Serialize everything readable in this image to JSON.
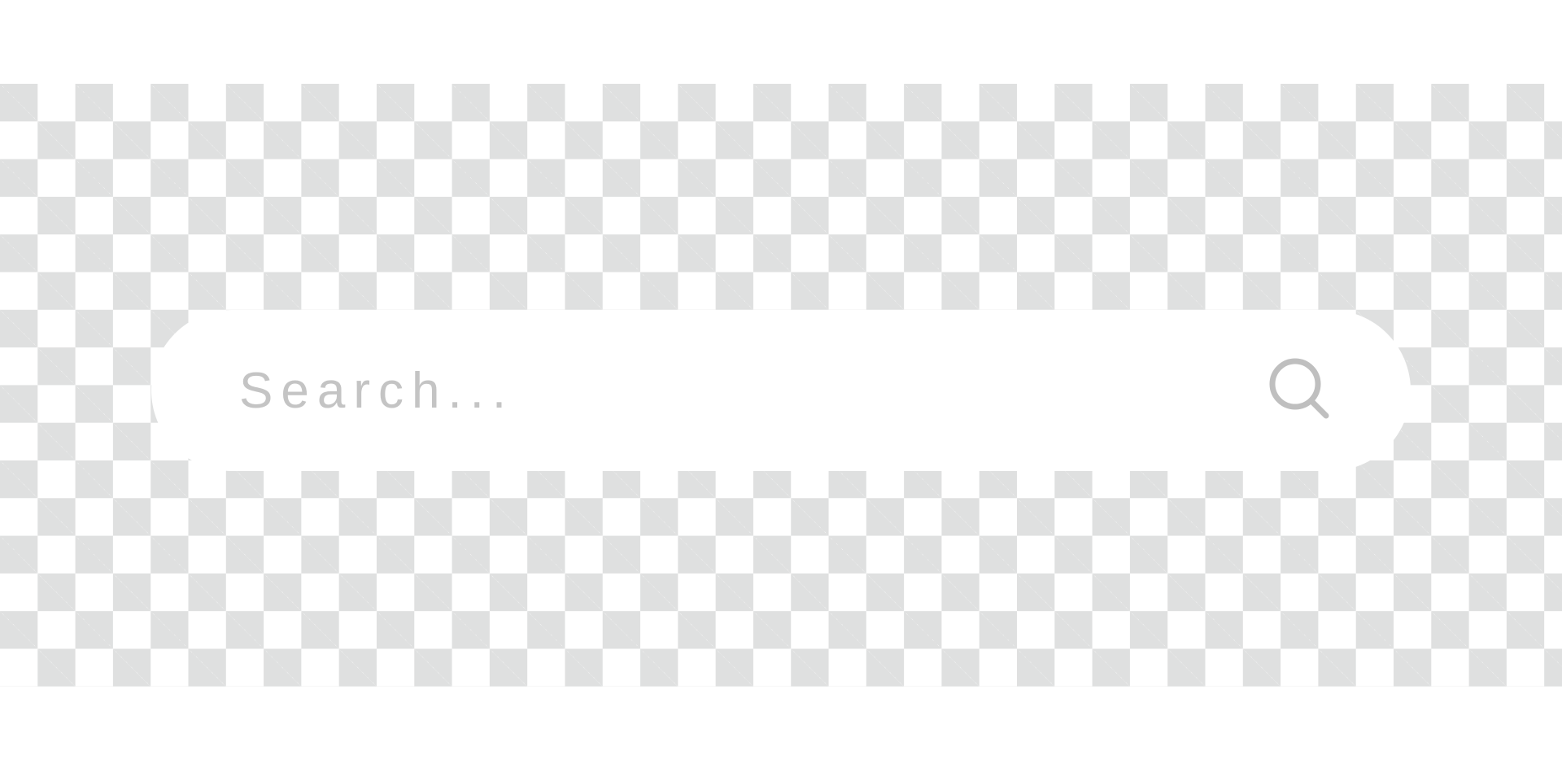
{
  "search": {
    "placeholder": "Search...",
    "icon": "search-icon"
  },
  "colors": {
    "checker_light": "#ffffff",
    "checker_dark": "#dfe0e0",
    "search_bar_background": "#ffffff",
    "placeholder_text": "#c4c4c4",
    "icon": "#bfbfbf"
  }
}
